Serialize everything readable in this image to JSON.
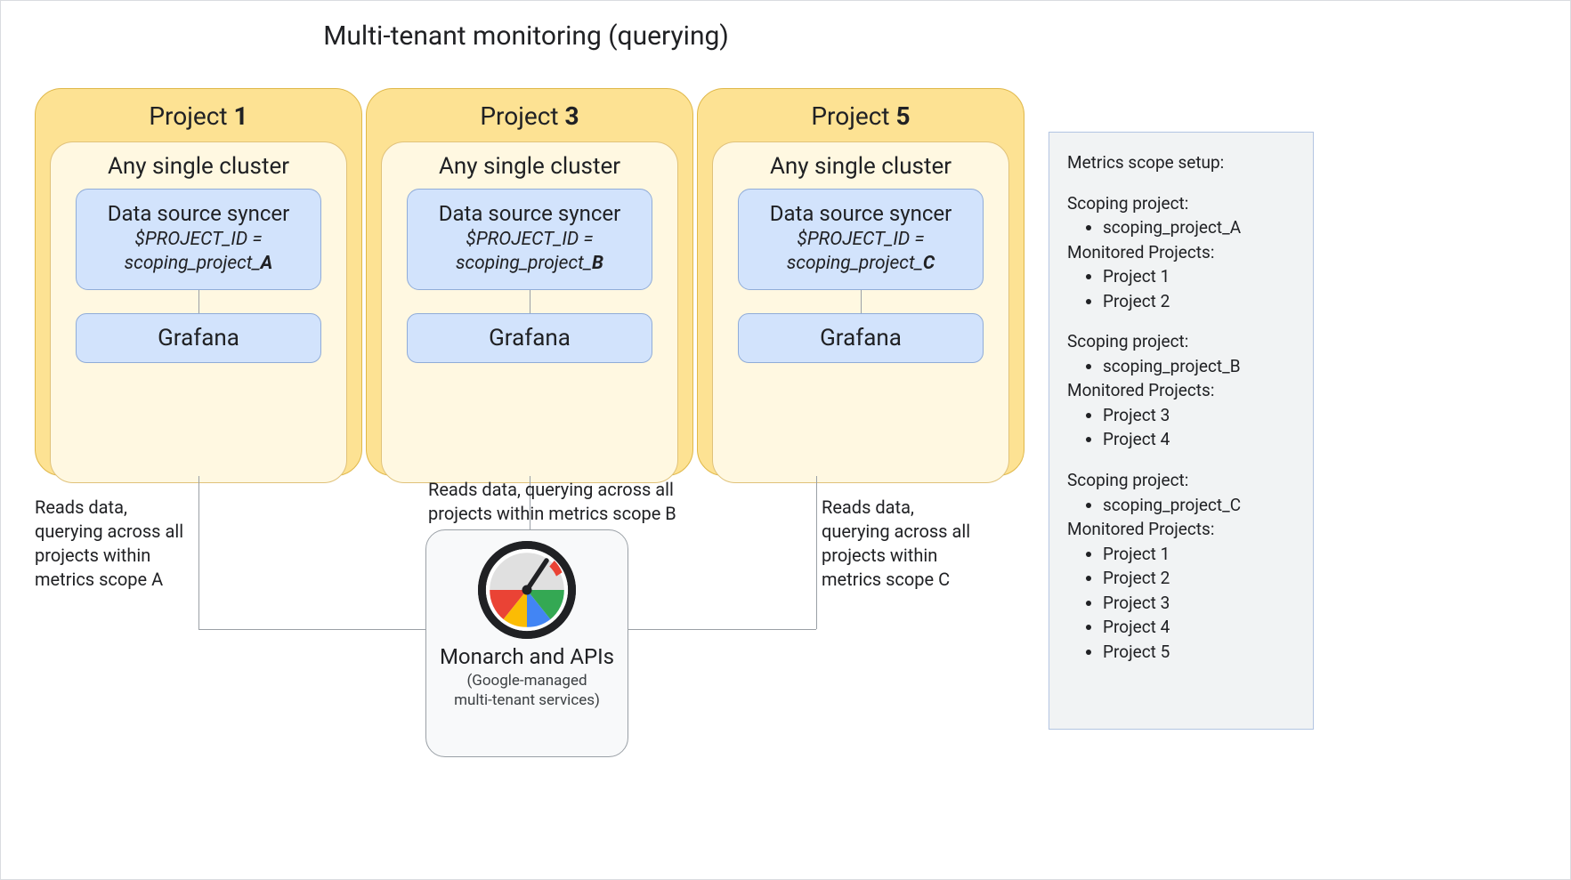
{
  "title": "Multi-tenant monitoring (querying)",
  "projects": [
    {
      "label_pre": "Project ",
      "label_num": "1",
      "cluster": "Any single cluster",
      "syncer_top": "Data source syncer",
      "syncer_var": "$PROJECT_ID =",
      "syncer_scope_pre": "scoping_project_",
      "syncer_scope_suf": "A",
      "grafana": "Grafana"
    },
    {
      "label_pre": "Project ",
      "label_num": "3",
      "cluster": "Any single cluster",
      "syncer_top": "Data source syncer",
      "syncer_var": "$PROJECT_ID =",
      "syncer_scope_pre": "scoping_project_",
      "syncer_scope_suf": "B",
      "grafana": "Grafana"
    },
    {
      "label_pre": "Project ",
      "label_num": "5",
      "cluster": "Any single cluster",
      "syncer_top": "Data source syncer",
      "syncer_var": "$PROJECT_ID =",
      "syncer_scope_pre": "scoping_project_",
      "syncer_scope_suf": "C",
      "grafana": "Grafana"
    }
  ],
  "annotations": {
    "a": "Reads data, querying across all projects within metrics scope A",
    "b": "Reads data, querying across all projects within metrics scope B",
    "c": "Reads data, querying across all projects within metrics scope C"
  },
  "monarch": {
    "title": "Monarch and APIs",
    "sub1": "(Google-managed",
    "sub2": "multi-tenant services)"
  },
  "side": {
    "header": "Metrics scope setup:",
    "blocks": [
      {
        "scoping_label": "Scoping project:",
        "scoping": "scoping_project_A",
        "mon_label": "Monitored Projects:",
        "projects": [
          "Project 1",
          "Project 2"
        ]
      },
      {
        "scoping_label": "Scoping project:",
        "scoping": "scoping_project_B",
        "mon_label": "Monitored Projects:",
        "projects": [
          "Project 3",
          "Project 4"
        ]
      },
      {
        "scoping_label": "Scoping project:",
        "scoping": "scoping_project_C",
        "mon_label": "Monitored Projects:",
        "projects": [
          "Project 1",
          "Project 2",
          "Project 3",
          "Project 4",
          "Project 5"
        ]
      }
    ]
  }
}
